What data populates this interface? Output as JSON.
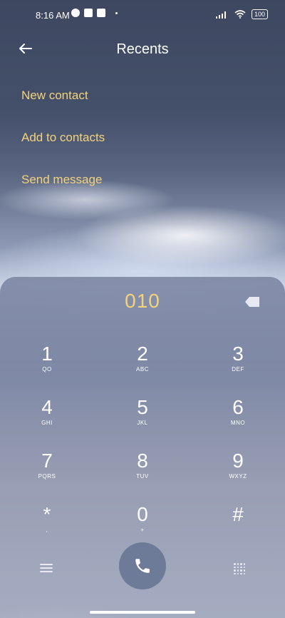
{
  "status_bar": {
    "time": "8:16 AM",
    "battery": "100"
  },
  "header": {
    "title": "Recents"
  },
  "actions": [
    {
      "label": "New contact"
    },
    {
      "label": "Add to contacts"
    },
    {
      "label": "Send message"
    }
  ],
  "dialpad": {
    "display": "010",
    "keys": [
      {
        "num": "1",
        "letters": "QO"
      },
      {
        "num": "2",
        "letters": "ABC"
      },
      {
        "num": "3",
        "letters": "DEF"
      },
      {
        "num": "4",
        "letters": "GHI"
      },
      {
        "num": "5",
        "letters": "JKL"
      },
      {
        "num": "6",
        "letters": "MNO"
      },
      {
        "num": "7",
        "letters": "PQRS"
      },
      {
        "num": "8",
        "letters": "TUV"
      },
      {
        "num": "9",
        "letters": "WXYZ"
      },
      {
        "num": "*",
        "letters": ","
      },
      {
        "num": "0",
        "letters": "+"
      },
      {
        "num": "#",
        "letters": ""
      }
    ]
  },
  "colors": {
    "accent": "#f3d27a",
    "call_button": "#6e7b98"
  }
}
